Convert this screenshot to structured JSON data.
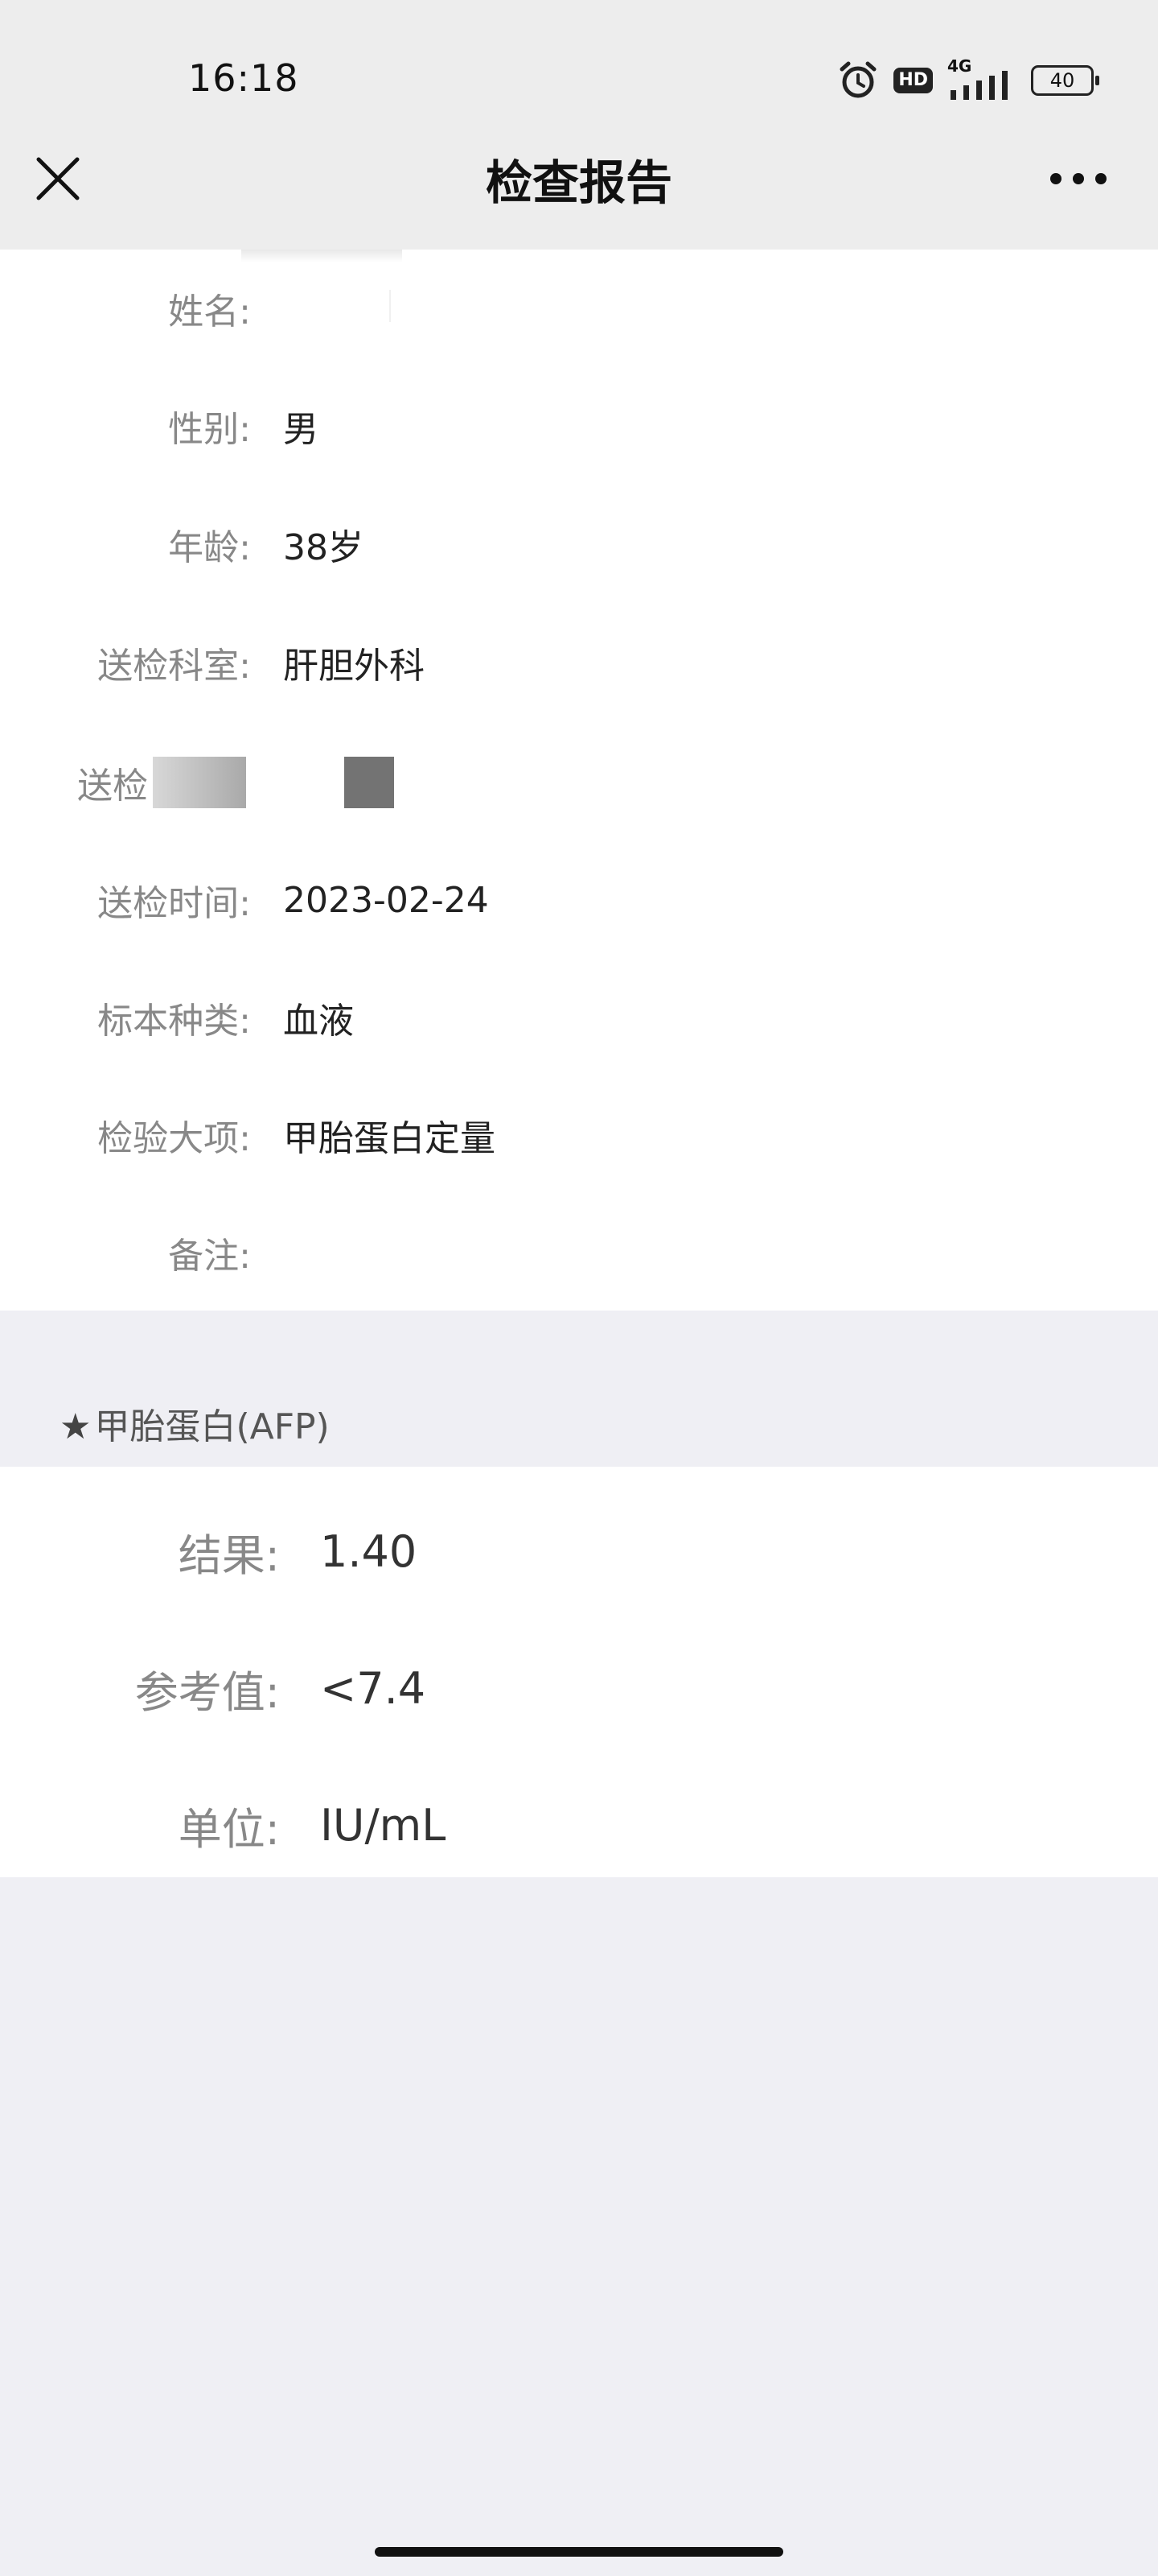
{
  "status_bar": {
    "time": "16:18",
    "hd": "HD",
    "network": "4G",
    "battery": "40"
  },
  "nav": {
    "title": "检查报告"
  },
  "patient_info": [
    {
      "label": "姓名:",
      "value": ""
    },
    {
      "label": "性别:",
      "value": "男"
    },
    {
      "label": "年龄:",
      "value": "38岁"
    },
    {
      "label": "送检科室:",
      "value": "肝胆外科"
    },
    {
      "label": "送检",
      "value": ""
    },
    {
      "label": "送检时间:",
      "value": "2023-02-24"
    },
    {
      "label": "标本种类:",
      "value": "血液"
    },
    {
      "label": "检验大项:",
      "value": "甲胎蛋白定量"
    },
    {
      "label": "备注:",
      "value": ""
    }
  ],
  "result_section": {
    "star": "★",
    "title": "甲胎蛋白(AFP)"
  },
  "results": [
    {
      "label": "结果:",
      "value": "1.40"
    },
    {
      "label": "参考值:",
      "value": "<7.4"
    },
    {
      "label": "单位:",
      "value": "IU/mL"
    }
  ]
}
